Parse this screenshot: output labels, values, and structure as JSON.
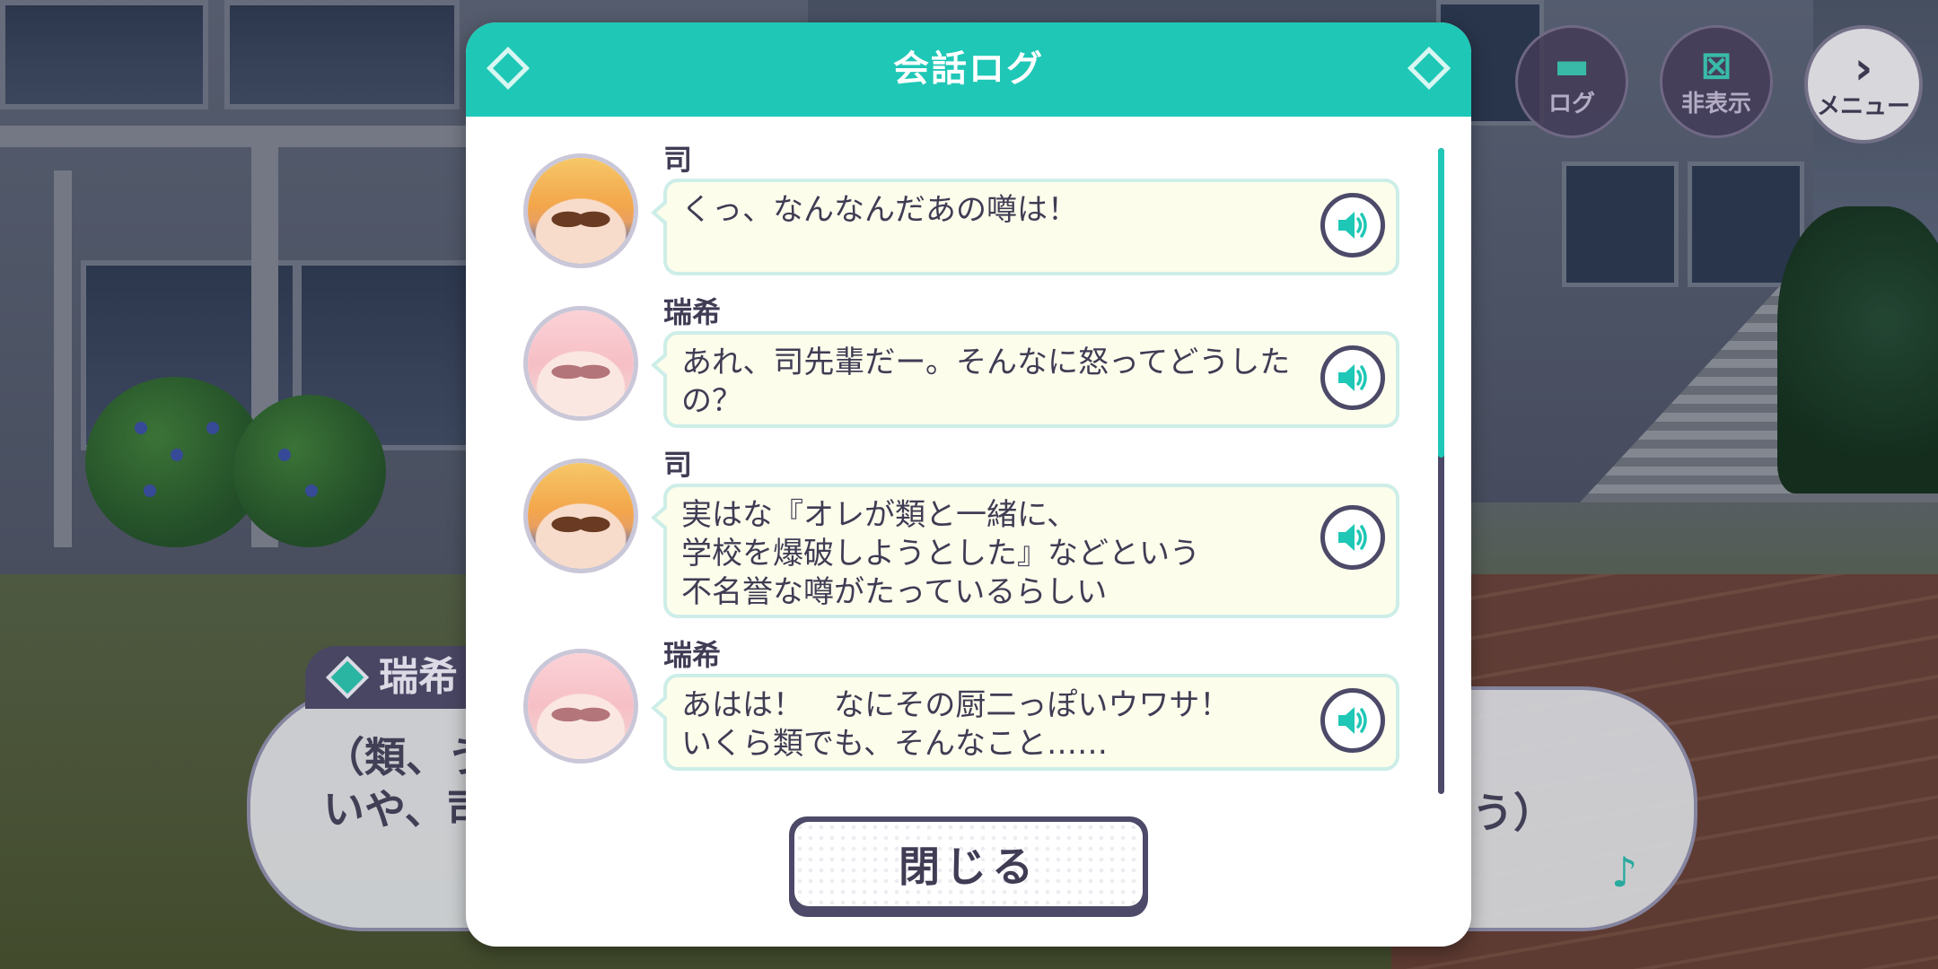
{
  "modal": {
    "title": "会話ログ",
    "close_label": "閉じる",
    "entries": [
      {
        "speaker": "司",
        "avatar": "tsukasa-avatar",
        "lines": [
          "くっ、なんなんだあの噂は！"
        ]
      },
      {
        "speaker": "瑞希",
        "avatar": "mizuki-avatar",
        "lines": [
          "あれ、司先輩だー。そんなに怒ってどうした",
          "の？"
        ]
      },
      {
        "speaker": "司",
        "avatar": "tsukasa-avatar",
        "lines": [
          "実はな『オレが類と一緒に、",
          "学校を爆破しようとした』などという",
          "不名誉な噂がたっているらしい"
        ]
      },
      {
        "speaker": "瑞希",
        "avatar": "mizuki-avatar",
        "lines": [
          "あはは！　なにその厨二っぽいウワサ！",
          "いくら類でも、そんなこと……"
        ]
      }
    ]
  },
  "top_buttons": {
    "log_label": "ログ",
    "hide_label": "非表示",
    "menu_label": "メニュー"
  },
  "background_dialog": {
    "speaker": "瑞希",
    "line1": "（類、う",
    "line2": "いや、司",
    "tail": "う）"
  },
  "colors": {
    "accent": "#1fc7b6",
    "dark": "#4c4a68",
    "bubble_bg": "#fdfdec"
  }
}
